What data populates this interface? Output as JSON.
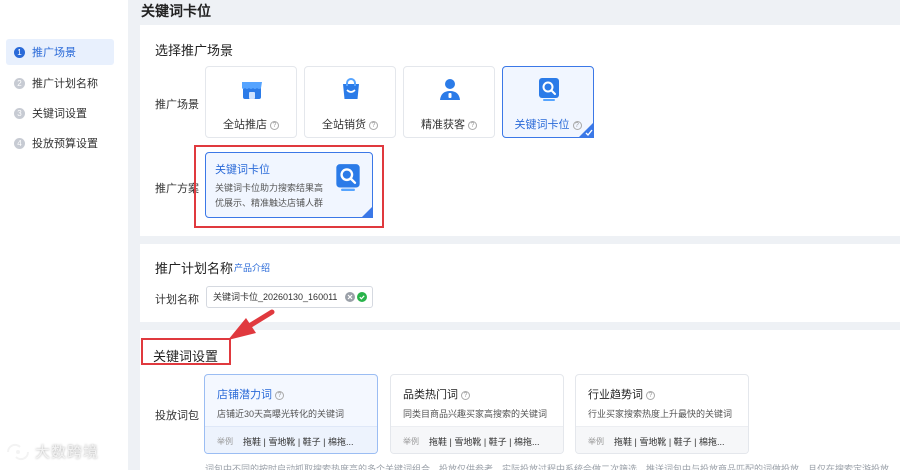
{
  "page_title": "关键词卡位",
  "colors": {
    "accent": "#2a6ad8",
    "annotation_red": "#e0393e"
  },
  "sidebar": {
    "steps": [
      {
        "num": "1",
        "label": "推广场景",
        "active": true
      },
      {
        "num": "2",
        "label": "推广计划名称",
        "active": false
      },
      {
        "num": "3",
        "label": "关键词设置",
        "active": false
      },
      {
        "num": "4",
        "label": "投放预算设置",
        "active": false
      }
    ]
  },
  "scene_section": {
    "title": "选择推广场景",
    "scene_label": "推广场景",
    "plan_label": "推广方案",
    "scenes": [
      {
        "label": "全站推店",
        "icon": "store-icon",
        "selected": false
      },
      {
        "label": "全站销货",
        "icon": "shopping-bag-icon",
        "selected": false
      },
      {
        "label": "精准获客",
        "icon": "user-target-icon",
        "selected": false
      },
      {
        "label": "关键词卡位",
        "icon": "keyword-search-icon",
        "selected": true
      }
    ],
    "plan_card": {
      "title": "关键词卡位",
      "desc": "关键词卡位助力搜索结果高优展示、精准触达店铺人群",
      "icon": "keyword-search-icon"
    }
  },
  "name_section": {
    "title": "推广计划名称",
    "product_link": "产品介绍",
    "field_label": "计划名称",
    "field_value": "关键词卡位_20260130_160011"
  },
  "keyword_section": {
    "title": "关键词设置",
    "package_label": "投放词包",
    "example_label": "举例",
    "cards": [
      {
        "title": "店铺潜力词",
        "desc": "店铺近30天高曝光转化的关键词",
        "examples": "拖鞋 | 雪地靴 | 鞋子 | 棉拖...",
        "selected": true
      },
      {
        "title": "品类热门词",
        "desc": "同类目商品兴趣买家高搜索的关键词",
        "examples": "拖鞋 | 雪地靴 | 鞋子 | 棉拖...",
        "selected": false
      },
      {
        "title": "行业趋势词",
        "desc": "行业买家搜索热度上升最快的关键词",
        "examples": "拖鞋 | 雪地靴 | 鞋子 | 棉拖...",
        "selected": false
      }
    ],
    "footnote": "词包中不同的按时启动抓取搜索热度高的多个关键词组合，投放仅供参考，实际投放过程中系统会做二次筛选，推送词包中与投放商品匹配的词做投放，且仅在搜索定游投放"
  },
  "watermark": "大数跨境"
}
